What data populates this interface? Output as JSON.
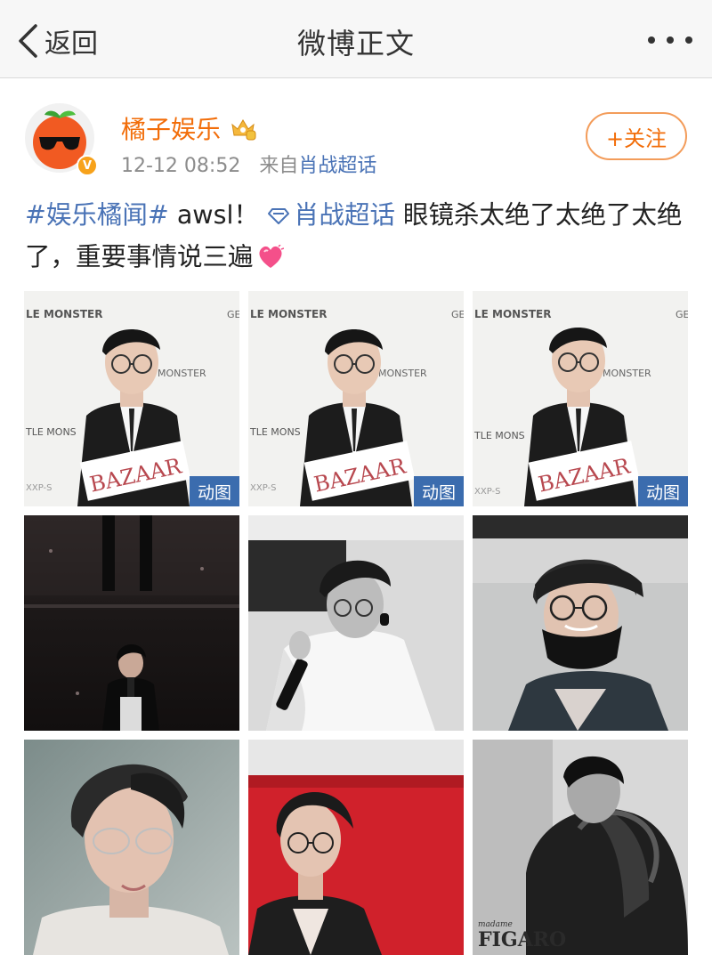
{
  "nav": {
    "back_label": "返回",
    "title": "微博正文"
  },
  "post": {
    "author": "橘子娱乐",
    "time": "12-12 08:52",
    "from_prefix": "来自",
    "source": "肖战超话",
    "follow_label": "+关注",
    "text": {
      "hashtag": "#娱乐橘闻#",
      "part1": " awsl！ ",
      "super_topic": "肖战超话",
      "part2": " 眼镜杀太绝了太绝了太绝了，重要事情说三遍"
    }
  },
  "images": [
    {
      "id": 1,
      "badge": "动图"
    },
    {
      "id": 2,
      "badge": "动图"
    },
    {
      "id": 3,
      "badge": "动图"
    },
    {
      "id": 4,
      "badge": ""
    },
    {
      "id": 5,
      "badge": ""
    },
    {
      "id": 6,
      "badge": ""
    },
    {
      "id": 7,
      "badge": ""
    },
    {
      "id": 8,
      "badge": ""
    },
    {
      "id": 9,
      "badge": ""
    }
  ],
  "photo_text": {
    "bazaar": "BAZAAR",
    "backdrop_1": "LE MONSTER",
    "backdrop_2": "MONSTER",
    "backdrop_3": "TLE MONS",
    "backdrop_4": "GE",
    "backdrop_5": "XXP-S",
    "magazine": "FIGARO",
    "magazine_small": "madame"
  },
  "icons": {
    "back": "chevron-left-icon",
    "more": "more-dots-icon",
    "verified": "verified-v-icon",
    "vip": "crown-badge-icon",
    "super_topic": "diamond-icon",
    "emoji": "heart-emoji-icon"
  },
  "colors": {
    "author_orange": "#f26d09",
    "link_blue": "#4a73b6",
    "gif_badge": "#3b6cae"
  }
}
